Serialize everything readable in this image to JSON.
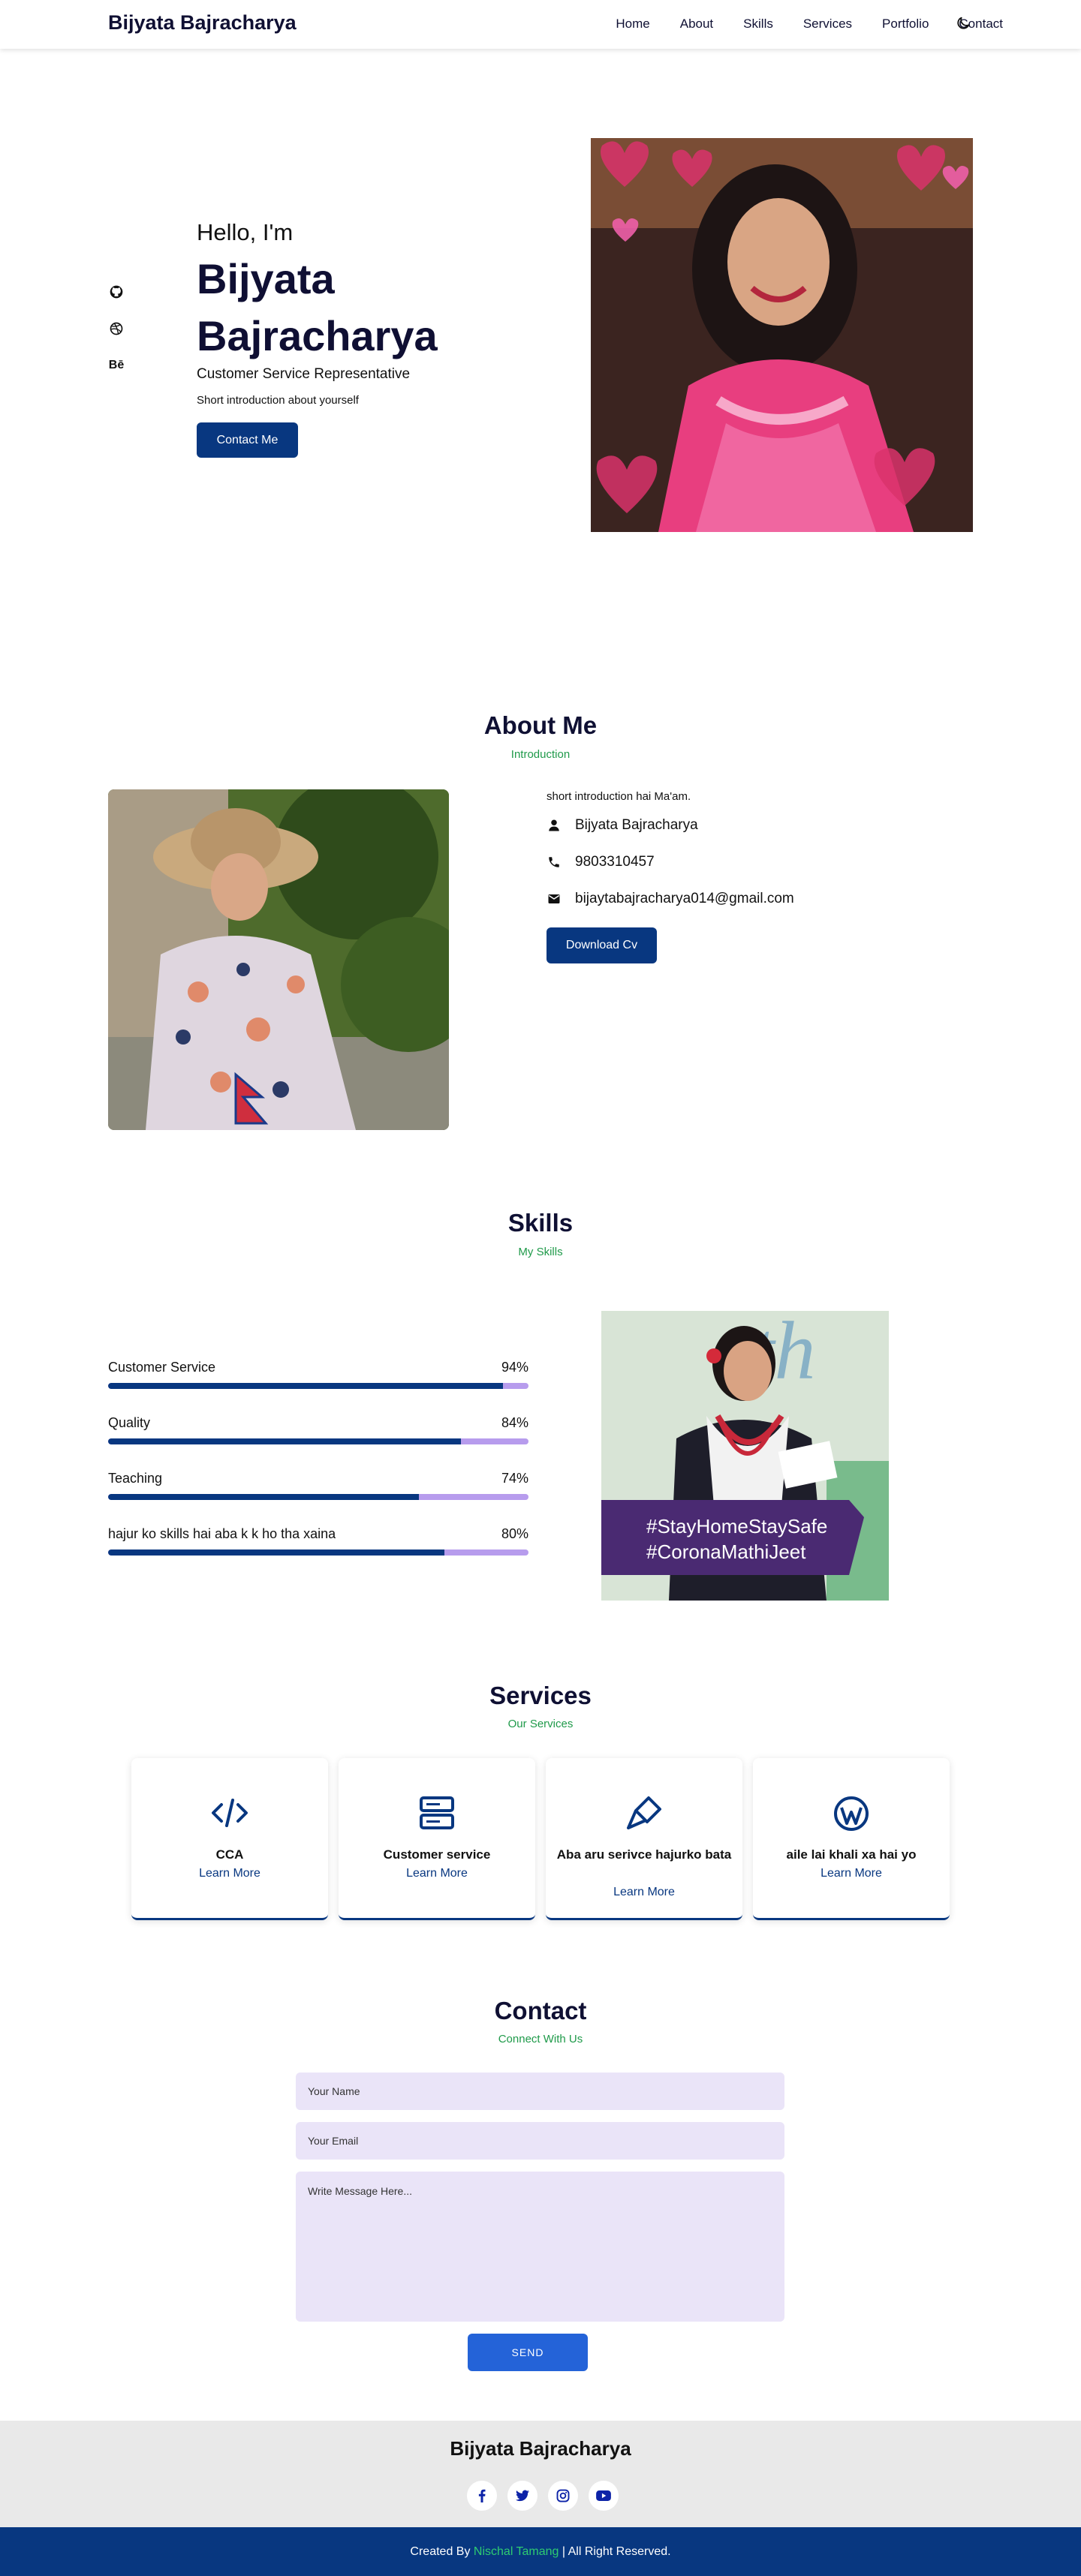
{
  "header": {
    "brand": "Bijyata Bajracharya",
    "nav": [
      "Home",
      "About",
      "Skills",
      "Services",
      "Portfolio",
      "Contact"
    ]
  },
  "hero": {
    "greeting": "Hello, I'm",
    "name": "Bijyata Bajracharya",
    "role": "Customer Service Representative",
    "intro": "Short introduction about yourself",
    "button": "Contact Me",
    "social_icons": [
      "github-icon",
      "dribbble-icon",
      "behance-icon"
    ],
    "behance_text": "Bē"
  },
  "about": {
    "title": "About Me",
    "subtitle": "Introduction",
    "intro": "short introduction hai Ma'am.",
    "name": "Bijyata Bajracharya",
    "phone": "9803310457",
    "email": "bijaytabajracharya014@gmail.com",
    "button": "Download Cv"
  },
  "skills": {
    "title": "Skills",
    "subtitle": "My Skills",
    "items": [
      {
        "name": "Customer Service",
        "percent_label": "94%",
        "percent": 94
      },
      {
        "name": "Quality",
        "percent_label": "84%",
        "percent": 84
      },
      {
        "name": "Teaching",
        "percent_label": "74%",
        "percent": 74
      },
      {
        "name": "hajur ko skills hai aba k k ho tha xaina",
        "percent_label": "80%",
        "percent": 80
      }
    ],
    "banner_line1": "#StayHomeStaySafe",
    "banner_line2": "#CoronaMathiJeet"
  },
  "services": {
    "title": "Services",
    "subtitle": "Our Services",
    "cards": [
      {
        "icon": "code-icon",
        "title": "CCA",
        "link": "Learn More"
      },
      {
        "icon": "server-icon",
        "title": "Customer service",
        "link": "Learn More"
      },
      {
        "icon": "paint-brush-icon",
        "title": "Aba aru serivce hajurko bata",
        "link": "Learn More"
      },
      {
        "icon": "wordpress-icon",
        "title": "aile lai khali xa hai yo",
        "link": "Learn More"
      }
    ]
  },
  "contact": {
    "title": "Contact",
    "subtitle": "Connect With Us",
    "name_placeholder": "Your Name",
    "email_placeholder": "Your Email",
    "message_placeholder": "Write Message Here...",
    "button": "SEND"
  },
  "footer": {
    "name": "Bijyata Bajracharya",
    "social": [
      "facebook-icon",
      "twitter-icon",
      "instagram-icon",
      "youtube-icon"
    ],
    "credit_prefix": "Created By ",
    "credit_author": "Nischal Tamang",
    "credit_suffix": " | All Right Reserved."
  },
  "colors": {
    "primary": "#083780",
    "accent_green": "#1f9a4a",
    "skill_track": "#b79ced",
    "input_bg": "#eae4f8",
    "send_button": "#2463d8"
  }
}
